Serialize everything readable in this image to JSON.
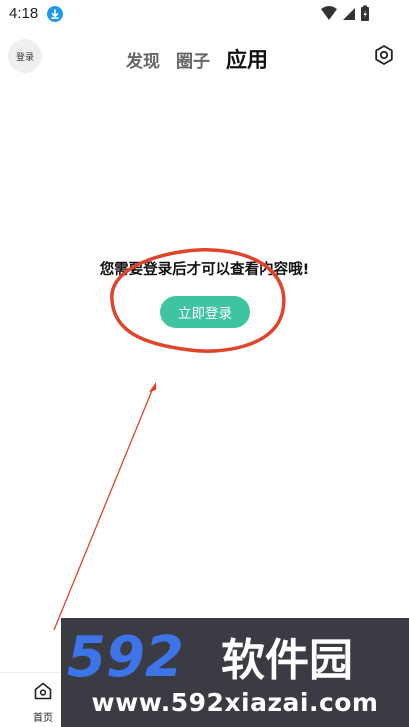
{
  "status_bar": {
    "time": "4:18",
    "icons": [
      "download-icon",
      "wifi-icon",
      "signal-icon",
      "battery-icon"
    ]
  },
  "header": {
    "login_label": "登录",
    "tabs": [
      {
        "label": "发现",
        "active": false
      },
      {
        "label": "圈子",
        "active": false
      },
      {
        "label": "应用",
        "active": true
      }
    ],
    "settings_icon": "gear-icon"
  },
  "main": {
    "prompt": "您需要登录后才可以查看内容哦!",
    "login_button": "立即登录"
  },
  "annotation": {
    "color": "#e0452c"
  },
  "bottom_nav": {
    "items": [
      {
        "label": "首页",
        "icon": "home-icon"
      }
    ]
  },
  "watermark": {
    "digits": "592",
    "brand": "软件园",
    "url": "www.592xiazai.com",
    "digit_color": "#3d74e8",
    "brand_color": "#ffffff"
  },
  "colors": {
    "accent": "#3fc4a1",
    "watermark_bg": "#3b3b43"
  }
}
